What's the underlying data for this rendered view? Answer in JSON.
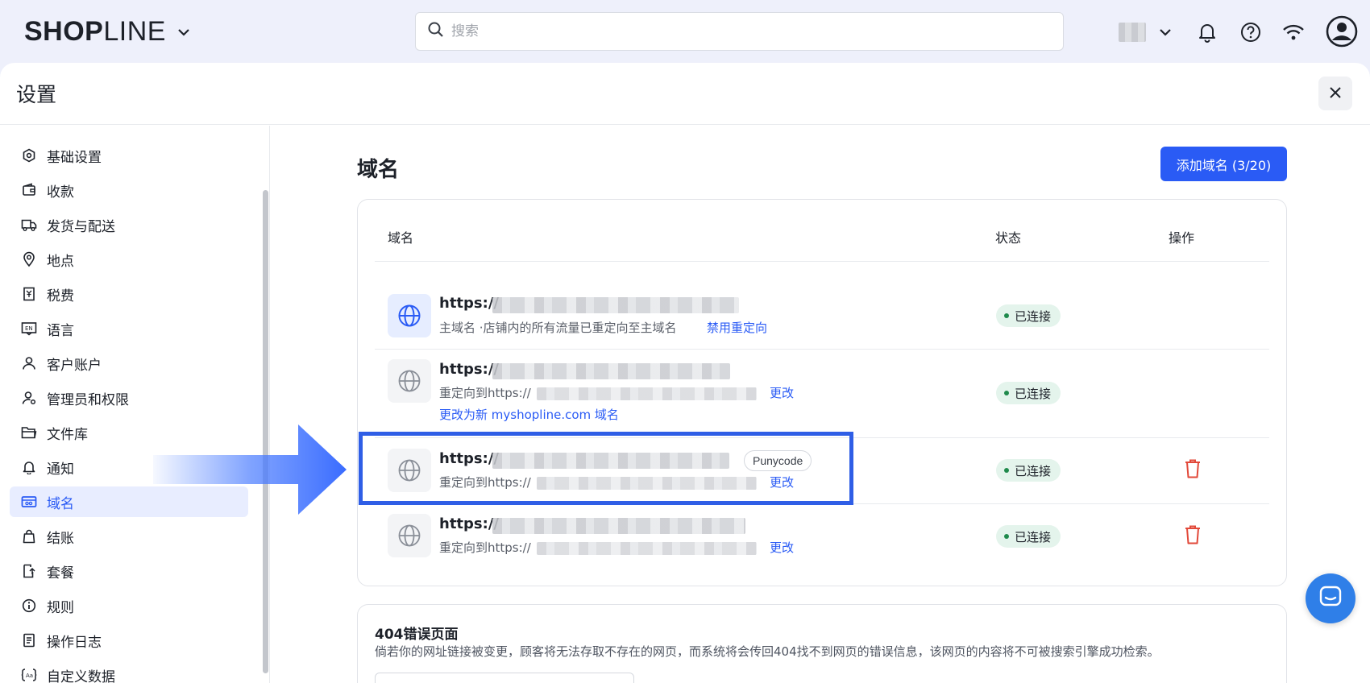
{
  "brand": {
    "logo_bold": "SHOP",
    "logo_light": "LINE"
  },
  "search": {
    "placeholder": "搜索"
  },
  "panel": {
    "title": "设置"
  },
  "sidebar": {
    "items": [
      {
        "label": "基础设置",
        "icon": "settings-hex-icon"
      },
      {
        "label": "收款",
        "icon": "wallet-icon"
      },
      {
        "label": "发货与配送",
        "icon": "truck-icon"
      },
      {
        "label": "地点",
        "icon": "location-pin-icon"
      },
      {
        "label": "税费",
        "icon": "receipt-icon"
      },
      {
        "label": "语言",
        "icon": "language-icon"
      },
      {
        "label": "客户账户",
        "icon": "user-icon"
      },
      {
        "label": "管理员和权限",
        "icon": "user-gear-icon"
      },
      {
        "label": "文件库",
        "icon": "folder-icon"
      },
      {
        "label": "通知",
        "icon": "bell-icon"
      },
      {
        "label": "域名",
        "icon": "domain-icon",
        "active": true
      },
      {
        "label": "结账",
        "icon": "shopping-bag-icon"
      },
      {
        "label": "套餐",
        "icon": "plan-icon"
      },
      {
        "label": "规则",
        "icon": "info-circle-icon"
      },
      {
        "label": "操作日志",
        "icon": "log-icon"
      },
      {
        "label": "自定义数据",
        "icon": "custom-data-icon"
      }
    ]
  },
  "domains": {
    "title": "域名",
    "add_button": "添加域名 (3/20)",
    "columns": {
      "domain": "域名",
      "status": "状态",
      "actions": "操作"
    },
    "rows": [
      {
        "url": "https://",
        "note": "主域名 ·店铺内的所有流量已重定向至主域名",
        "action_link": "禁用重定向",
        "status": "已连接"
      },
      {
        "url": "https://",
        "note": "重定向到https://",
        "action_link": "更改",
        "extra_link": "更改为新 myshopline.com 域名",
        "status": "已连接"
      },
      {
        "url": "https://",
        "tag": "Punycode",
        "note": "重定向到https://",
        "action_link": "更改",
        "status": "已连接"
      },
      {
        "url": "https://",
        "note": "重定向到https://",
        "action_link": "更改",
        "status": "已连接"
      }
    ]
  },
  "error_page": {
    "title": "404错误页面",
    "description": "倘若你的网址链接被变更，顾客将无法存取不存在的网页，而系统将会传回404找不到网页的错误信息，该网页的内容将不可被搜索引擎成功检索。"
  },
  "colors": {
    "accent": "#2a5bf5",
    "status_bg": "#e4f4ec",
    "status_dot": "#1f8a4c",
    "danger": "#e2493a",
    "highlight": "#2f5ee6"
  }
}
